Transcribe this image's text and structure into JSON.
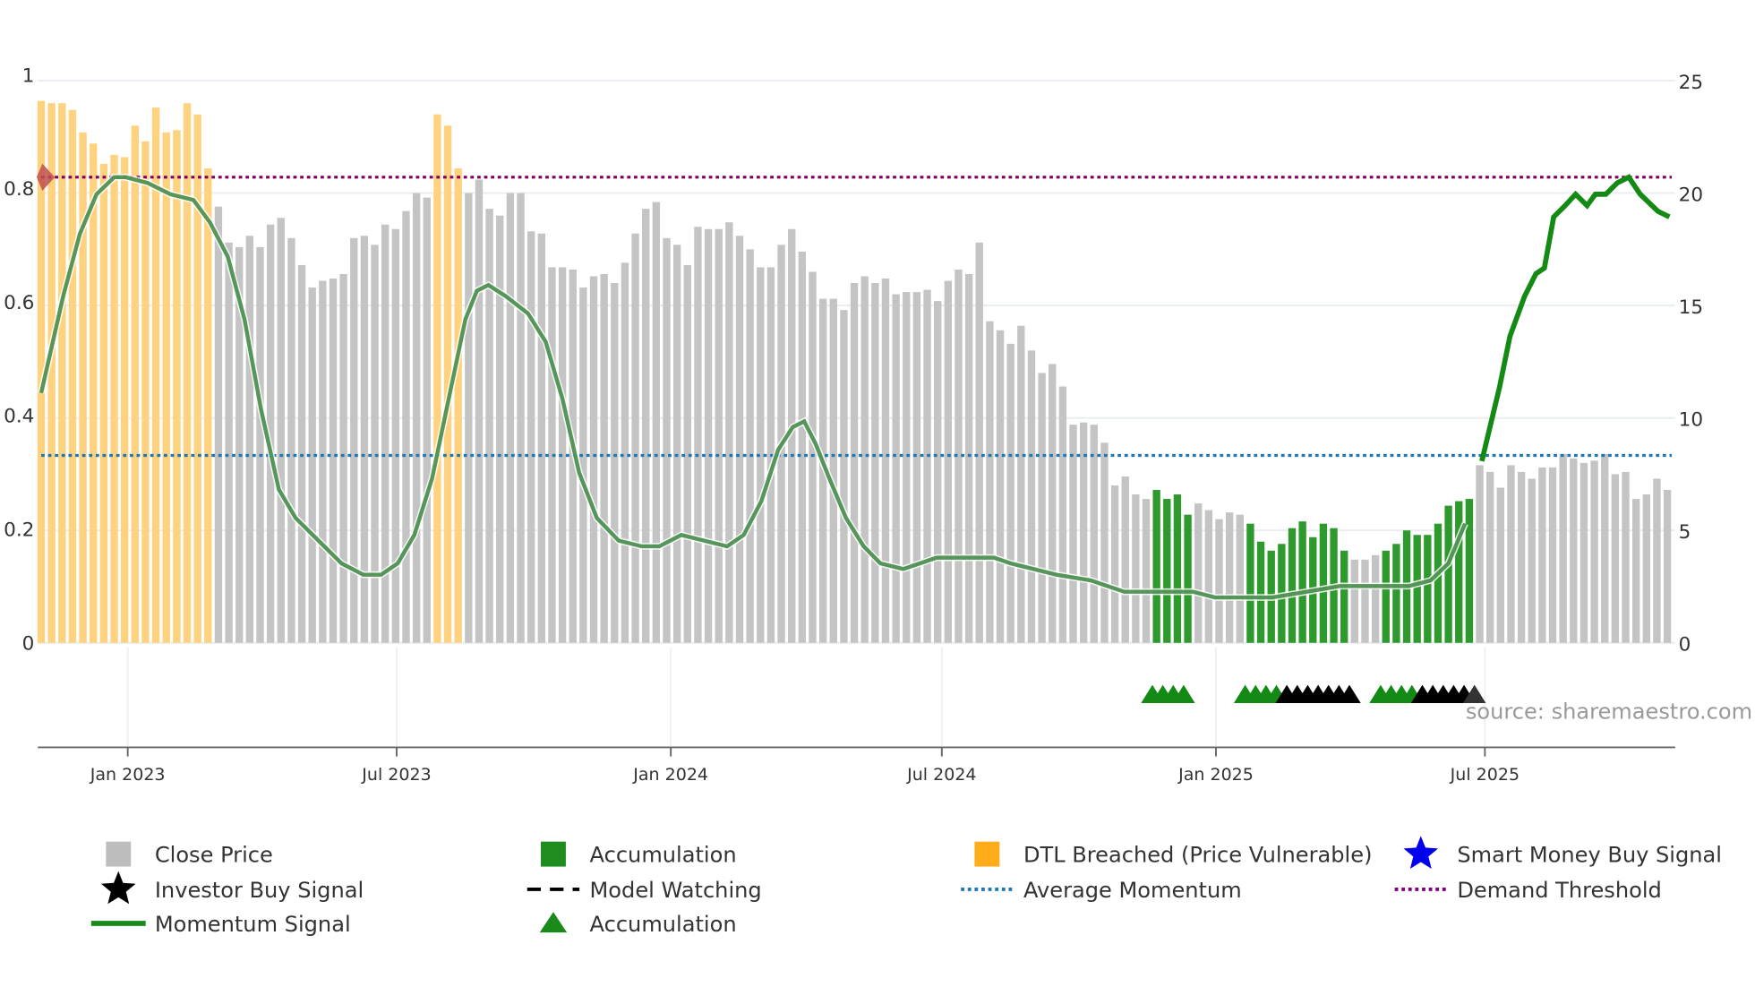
{
  "chart_data": {
    "type": "bar",
    "title": "",
    "x_unit": "week index",
    "x_ticks": [
      {
        "week": 8.3,
        "label": "Jan 2023"
      },
      {
        "week": 34.1,
        "label": "Jul 2023"
      },
      {
        "week": 60.4,
        "label": "Jan 2024"
      },
      {
        "week": 86.4,
        "label": "Jul 2024"
      },
      {
        "week": 112.7,
        "label": "Jan 2025"
      },
      {
        "week": 138.5,
        "label": "Jul 2025"
      }
    ],
    "left_axis": {
      "range": [
        0,
        1
      ],
      "ticks": [
        "0",
        "0.2",
        "0.4",
        "0.6",
        "0.8",
        "1"
      ]
    },
    "right_axis": {
      "range": [
        0,
        25
      ],
      "ticks": [
        "0",
        "5",
        "10",
        "15",
        "20",
        "25"
      ]
    },
    "close_price": [
      24.1,
      24,
      24,
      23.7,
      22.7,
      22.2,
      21.3,
      21.7,
      21.6,
      23,
      22.3,
      23.8,
      22.7,
      22.8,
      24,
      23.5,
      21.1,
      19.4,
      17.8,
      17.6,
      18.1,
      17.6,
      18.6,
      18.9,
      18,
      16.8,
      15.8,
      16.1,
      16.2,
      16.4,
      18,
      18.1,
      17.7,
      18.6,
      18.4,
      19.2,
      20,
      19.8,
      23.5,
      23,
      21.1,
      20,
      20.6,
      19.3,
      19,
      20,
      20,
      18.3,
      18.2,
      16.7,
      16.7,
      16.6,
      15.8,
      16.3,
      16.4,
      16,
      16.9,
      18.2,
      19.3,
      19.6,
      18,
      17.7,
      16.8,
      18.5,
      18.4,
      18.4,
      18.7,
      18.1,
      17.5,
      16.7,
      16.7,
      17.7,
      18.4,
      17.4,
      16.5,
      15.3,
      15.3,
      14.8,
      16,
      16.3,
      16,
      16.2,
      15.5,
      15.6,
      15.6,
      15.7,
      15.2,
      16.1,
      16.6,
      16.4,
      17.8,
      14.3,
      13.9,
      13.3,
      14.1,
      13,
      12,
      12.4,
      11.4,
      9.7,
      9.8,
      9.7,
      8.9,
      7,
      7.4,
      6.6,
      6.4,
      6.8,
      6.4,
      6.6,
      5.7,
      6.2,
      5.9,
      5.5,
      5.8,
      5.7,
      5.3,
      4.5,
      4.1,
      4.4,
      5.1,
      5.4,
      4.7,
      5.3,
      5.1,
      4.1,
      3.7,
      3.7,
      3.9,
      4.1,
      4.4,
      5,
      4.8,
      4.8,
      5.3,
      6.1,
      6.3,
      6.4,
      7.9,
      7.6,
      6.9,
      7.9,
      7.6,
      7.3,
      7.8,
      7.8,
      8.4,
      8.2,
      8,
      8.1,
      8.4,
      7.5,
      7.6,
      6.4,
      6.6,
      7.3,
      6.8
    ],
    "bar_state_runs": [
      [
        "dtl",
        17
      ],
      [
        "close",
        21
      ],
      [
        "dtl",
        3
      ],
      [
        "close",
        50
      ],
      [
        "close",
        16
      ],
      [
        "acc",
        4
      ],
      [
        "close",
        5
      ],
      [
        "acc",
        10
      ],
      [
        "close",
        3
      ],
      [
        "acc",
        9
      ],
      [
        "close",
        19
      ]
    ],
    "momentum": [
      [
        0,
        0.44
      ],
      [
        2.1,
        0.61
      ],
      [
        3.7,
        0.72
      ],
      [
        5.3,
        0.79
      ],
      [
        7.0,
        0.82
      ],
      [
        8.1,
        0.82
      ],
      [
        10.2,
        0.81
      ],
      [
        12.4,
        0.79
      ],
      [
        14.6,
        0.78
      ],
      [
        16.2,
        0.74
      ],
      [
        17.9,
        0.68
      ],
      [
        19.5,
        0.57
      ],
      [
        21.1,
        0.41
      ],
      [
        22.8,
        0.27
      ],
      [
        24.4,
        0.22
      ],
      [
        26.6,
        0.18
      ],
      [
        28.8,
        0.14
      ],
      [
        30.9,
        0.12
      ],
      [
        32.6,
        0.12
      ],
      [
        34.2,
        0.14
      ],
      [
        35.8,
        0.19
      ],
      [
        37.5,
        0.29
      ],
      [
        39.1,
        0.43
      ],
      [
        40.7,
        0.57
      ],
      [
        41.8,
        0.62
      ],
      [
        42.9,
        0.63
      ],
      [
        44.6,
        0.61
      ],
      [
        46.7,
        0.58
      ],
      [
        48.4,
        0.53
      ],
      [
        50.0,
        0.43
      ],
      [
        51.6,
        0.3
      ],
      [
        53.3,
        0.22
      ],
      [
        55.4,
        0.18
      ],
      [
        57.6,
        0.17
      ],
      [
        59.3,
        0.17
      ],
      [
        61.4,
        0.19
      ],
      [
        63.6,
        0.18
      ],
      [
        65.8,
        0.17
      ],
      [
        67.4,
        0.19
      ],
      [
        69.1,
        0.25
      ],
      [
        70.7,
        0.34
      ],
      [
        72.1,
        0.38
      ],
      [
        73.2,
        0.39
      ],
      [
        74.3,
        0.35
      ],
      [
        75.6,
        0.29
      ],
      [
        77.2,
        0.22
      ],
      [
        78.9,
        0.17
      ],
      [
        80.5,
        0.14
      ],
      [
        82.7,
        0.13
      ],
      [
        84.3,
        0.14
      ],
      [
        85.9,
        0.15
      ],
      [
        87.6,
        0.15
      ],
      [
        91.4,
        0.15
      ],
      [
        93.0,
        0.14
      ],
      [
        95.2,
        0.13
      ],
      [
        97.4,
        0.12
      ],
      [
        100.7,
        0.11
      ],
      [
        103.9,
        0.09
      ],
      [
        106.1,
        0.09
      ],
      [
        110.5,
        0.09
      ],
      [
        112.6,
        0.08
      ],
      [
        115.4,
        0.08
      ],
      [
        118.1,
        0.08
      ],
      [
        121.4,
        0.09
      ],
      [
        124.6,
        0.1
      ],
      [
        131.2,
        0.1
      ],
      [
        133.3,
        0.11
      ],
      [
        135.0,
        0.14
      ],
      [
        136.6,
        0.21
      ],
      [
        138.2,
        0.32
      ],
      [
        139.9,
        0.45
      ],
      [
        140.9,
        0.54
      ],
      [
        142.3,
        0.61
      ],
      [
        143.4,
        0.65
      ],
      [
        144.2,
        0.66
      ],
      [
        145.1,
        0.75
      ],
      [
        146.2,
        0.77
      ],
      [
        147.2,
        0.79
      ],
      [
        148.3,
        0.77
      ],
      [
        149.1,
        0.79
      ],
      [
        150.1,
        0.79
      ],
      [
        151.2,
        0.81
      ],
      [
        152.3,
        0.82
      ],
      [
        153.4,
        0.79
      ],
      [
        155.1,
        0.76
      ],
      [
        156.2,
        0.75
      ]
    ],
    "average_momentum": 0.33,
    "demand_threshold": 0.82,
    "signal_markers": [
      {
        "week": 106.6,
        "type": "accumulation"
      },
      {
        "week": 107.6,
        "type": "accumulation"
      },
      {
        "week": 108.6,
        "type": "accumulation"
      },
      {
        "week": 109.6,
        "type": "accumulation"
      },
      {
        "week": 115.5,
        "type": "accumulation"
      },
      {
        "week": 116.5,
        "type": "accumulation"
      },
      {
        "week": 117.5,
        "type": "accumulation"
      },
      {
        "week": 118.5,
        "type": "accumulation"
      },
      {
        "week": 119.5,
        "type": "watching"
      },
      {
        "week": 120.5,
        "type": "watching"
      },
      {
        "week": 121.5,
        "type": "watching"
      },
      {
        "week": 122.5,
        "type": "watching"
      },
      {
        "week": 123.5,
        "type": "watching"
      },
      {
        "week": 124.5,
        "type": "watching"
      },
      {
        "week": 125.5,
        "type": "watching"
      },
      {
        "week": 128.5,
        "type": "accumulation"
      },
      {
        "week": 129.5,
        "type": "accumulation"
      },
      {
        "week": 130.5,
        "type": "accumulation"
      },
      {
        "week": 131.5,
        "type": "accumulation"
      },
      {
        "week": 132.5,
        "type": "watching"
      },
      {
        "week": 133.5,
        "type": "watching"
      },
      {
        "week": 134.5,
        "type": "watching"
      },
      {
        "week": 135.5,
        "type": "watching"
      },
      {
        "week": 136.5,
        "type": "watching"
      },
      {
        "week": 137.5,
        "type": "other"
      }
    ],
    "source": "source: sharemaestro.com",
    "legend": [
      {
        "label": "Close Price",
        "symbol": "square",
        "color": "#bdbdbd"
      },
      {
        "label": "Accumulation",
        "symbol": "square",
        "color": "#1e8c1e"
      },
      {
        "label": "DTL Breached (Price Vulnerable)",
        "symbol": "square",
        "color": "#ffab1a"
      },
      {
        "label": "Smart Money Buy Signal",
        "symbol": "star",
        "color": "#0000ee"
      },
      {
        "label": "Investor Buy Signal",
        "symbol": "star",
        "color": "#000000"
      },
      {
        "label": "Model Watching",
        "symbol": "dash",
        "color": "#000000"
      },
      {
        "label": "Average Momentum",
        "symbol": "dot",
        "color": "#1f77b4"
      },
      {
        "label": "Demand Threshold",
        "symbol": "dot",
        "color": "#800080"
      },
      {
        "label": "Momentum Signal",
        "symbol": "line",
        "color": "#1a8a1a"
      },
      {
        "label": "Accumulation",
        "symbol": "triangle",
        "color": "#1a8a1a"
      }
    ],
    "legend_placement": "bottom"
  }
}
